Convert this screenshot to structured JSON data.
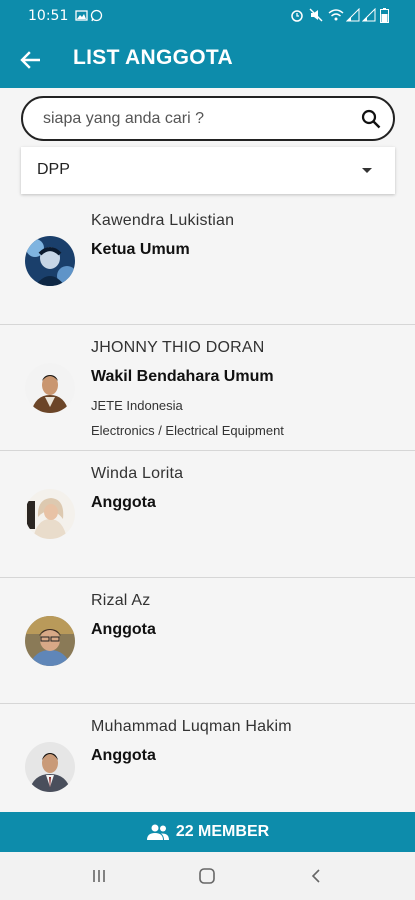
{
  "status_bar": {
    "time": "10:51"
  },
  "header": {
    "title": "LIST ANGGOTA",
    "back_icon": "arrow-left-icon"
  },
  "search": {
    "placeholder": "siapa yang anda cari ?",
    "value": "",
    "icon": "search-icon"
  },
  "filter": {
    "selected": "DPP"
  },
  "members": [
    {
      "name": "Kawendra Lukistian",
      "role": "Ketua Umum",
      "company": "",
      "sector": ""
    },
    {
      "name": "JHONNY THIO DORAN",
      "role": "Wakil Bendahara Umum",
      "company": "JETE Indonesia",
      "sector": "Electronics / Electrical Equipment"
    },
    {
      "name": "Winda Lorita",
      "role": "Anggota",
      "company": "",
      "sector": ""
    },
    {
      "name": "Rizal Az",
      "role": "Anggota",
      "company": "",
      "sector": ""
    },
    {
      "name": "Muhammad Luqman Hakim",
      "role": "Anggota",
      "company": "",
      "sector": ""
    }
  ],
  "footer": {
    "member_count": "22 MEMBER",
    "icon": "group-icon"
  },
  "colors": {
    "primary": "#0d8cab",
    "background": "#f5f5f5"
  }
}
